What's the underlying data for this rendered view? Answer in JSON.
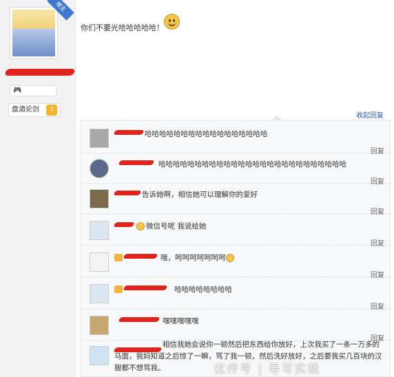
{
  "author": {
    "badge_label": "楼主",
    "game_badge": "🎮",
    "level_label": "盘酒论剑",
    "level_value": "7"
  },
  "post": {
    "text": "你们不要光哈哈哈哈哈！",
    "emoticon": "smiley-icon"
  },
  "replies_header": {
    "collapse_label": "收起回复"
  },
  "replies": [
    {
      "text": "哈哈哈哈哈哈哈哈哈哈哈哈哈哈哈哈哈",
      "reply_label": "回复"
    },
    {
      "text": "哈哈哈哈哈哈哈哈哈哈哈哈哈哈哈哈哈哈哈哈哈哈哈哈哈哈",
      "reply_label": "回复"
    },
    {
      "text": "告诉她啊，相信她可以理解你的爱好",
      "reply_label": "回复"
    },
    {
      "text": "微信号呢 我说给她",
      "reply_label": "回复"
    },
    {
      "text": "哦，呵呵呵呵呵呵呵",
      "reply_label": "回复"
    },
    {
      "text": "哈哈哈哈哈哈哈哈",
      "reply_label": "回复"
    },
    {
      "text": "嘿嘿嘿嘿嘿",
      "reply_label": "回复"
    },
    {
      "text": "相信我她会说你一顿然后把东西给你放好，上次我买了一条一万多的马面，我妈知道之后惊了一瞬，骂了我一顿，然后洗好放好，之后要我买几百块的汉服都不想骂我。"
    }
  ],
  "watermark": "优传号 | 导写实裁"
}
